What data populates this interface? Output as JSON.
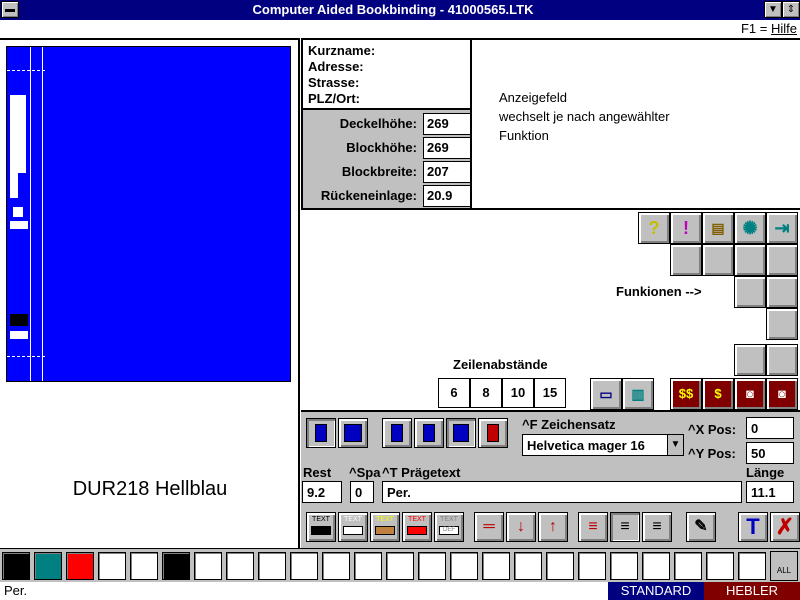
{
  "window": {
    "title": "Computer Aided Bookbinding - 41000565.LTK"
  },
  "help": {
    "key": "F1 = ",
    "label": "Hilfe"
  },
  "preview": {
    "color_label": "DUR218 Hellblau",
    "cover_color": "#0000ff"
  },
  "info": {
    "labels": [
      "Kurzname:",
      "Adresse:",
      "Strasse:",
      "PLZ/Ort:"
    ]
  },
  "display": {
    "lines": [
      "Anzeigefeld",
      "wechselt je nach angewählter",
      "Funktion"
    ]
  },
  "dimensions": [
    {
      "label": "Deckelhöhe:",
      "value": "269"
    },
    {
      "label": "Blockhöhe:",
      "value": "269"
    },
    {
      "label": "Blockbreite:",
      "value": "207"
    },
    {
      "label": "Rückeneinlage:",
      "value": "20.9"
    }
  ],
  "functions": {
    "label": "Funkionen -->",
    "icons": [
      "question-icon",
      "exclamation-icon",
      "filing-cabinet-icon",
      "cd-icon",
      "exit-door-icon"
    ]
  },
  "line_spacing": {
    "label": "Zeilenabstände",
    "values": [
      "6",
      "8",
      "10",
      "15"
    ]
  },
  "editor": {
    "font_label": "^F Zeichensatz",
    "font_value": "Helvetica mager 16",
    "x_pos_label": "^X Pos:",
    "x_pos_value": "0",
    "y_pos_label": "^Y Pos:",
    "y_pos_value": "50",
    "rest_label": "Rest",
    "rest_value": "9.2",
    "spa_label": "^Spa",
    "spa_value": "0",
    "text_label": "^T Prägetext",
    "text_value": "Per.",
    "laenge_label": "Länge",
    "laenge_value": "11.1",
    "text_style_label": "TEXT",
    "text_def_label": "DEF"
  },
  "palette": {
    "colors": [
      "#000000",
      "#008080",
      "#ff0000",
      "#ffffff",
      "#ffffff",
      "#000000",
      "#ffffff",
      "#ffffff",
      "#ffffff",
      "#ffffff",
      "#ffffff",
      "#ffffff",
      "#ffffff",
      "#ffffff",
      "#ffffff",
      "#ffffff",
      "#ffffff",
      "#ffffff",
      "#ffffff",
      "#ffffff",
      "#ffffff",
      "#ffffff",
      "#ffffff",
      "#ffffff"
    ],
    "all_label": "ALL"
  },
  "status": {
    "left": "Per.",
    "standard": "STANDARD",
    "hebler": "HEBLER"
  }
}
